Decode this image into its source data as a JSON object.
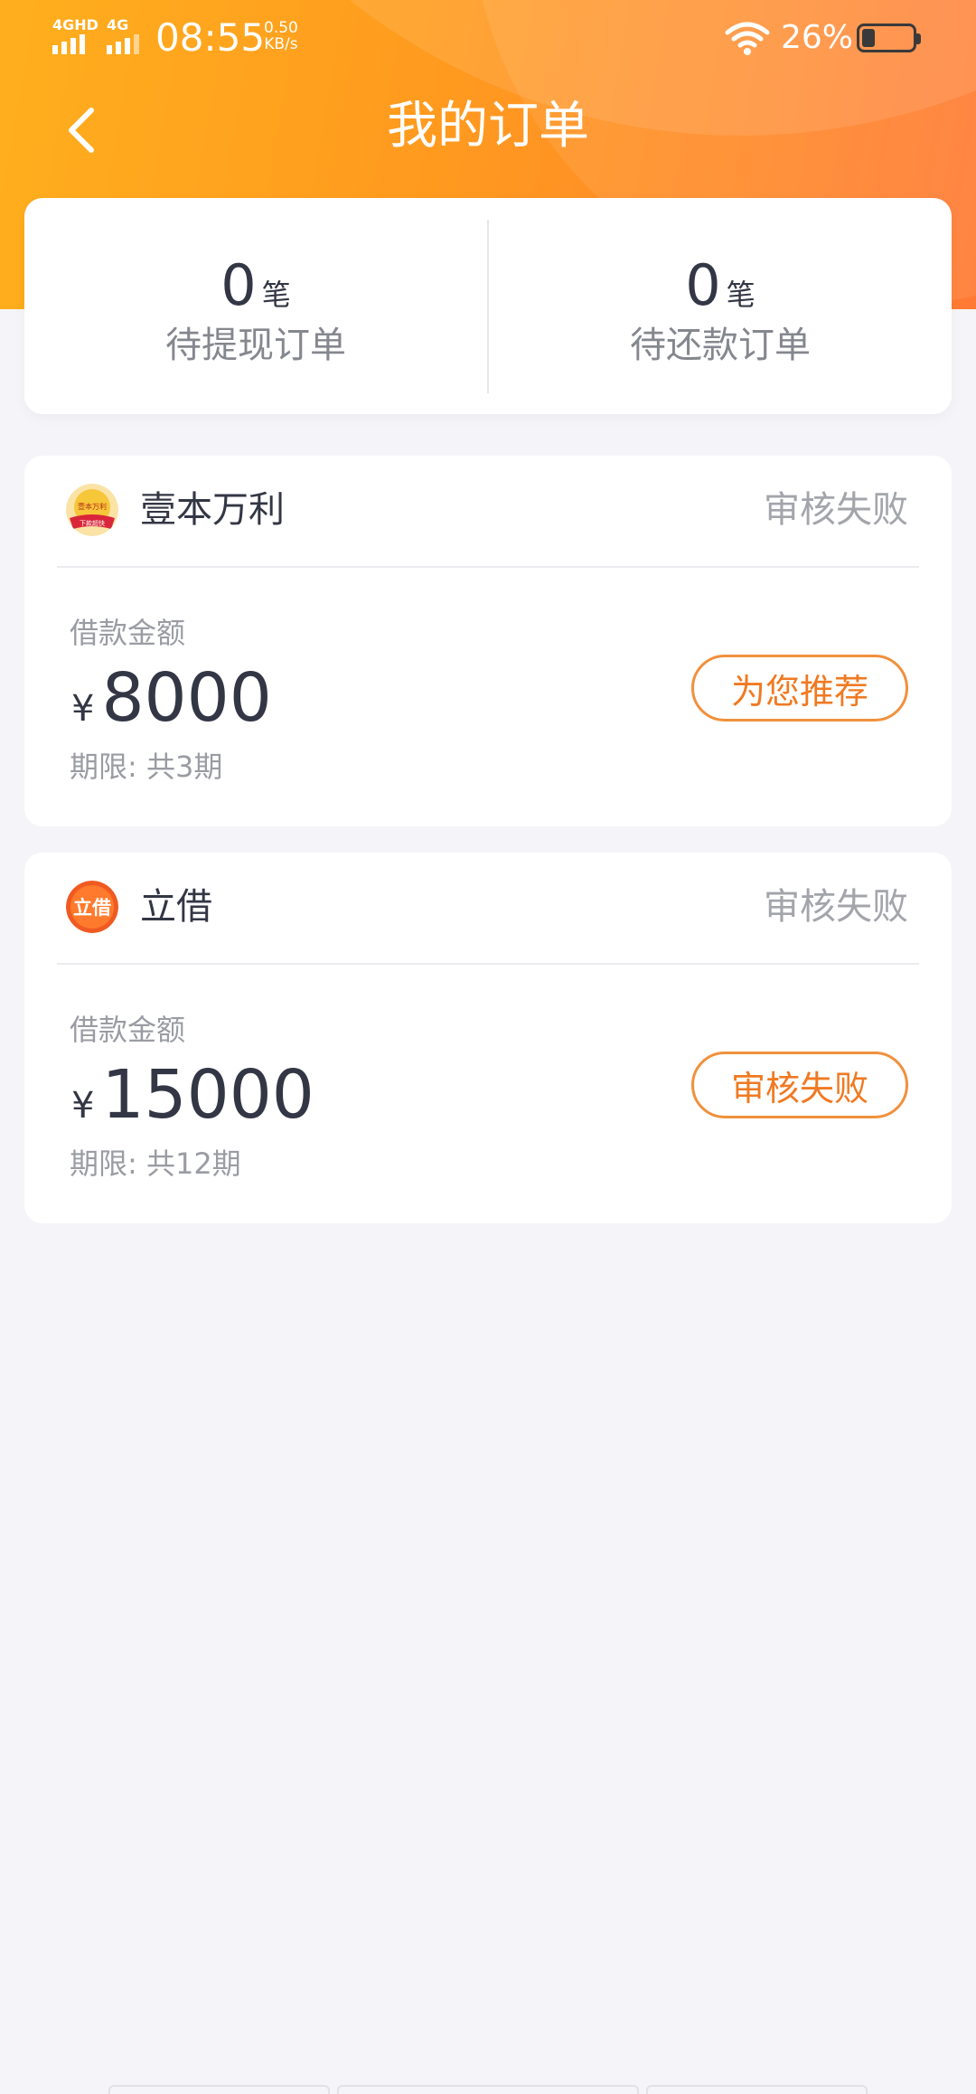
{
  "status_bar": {
    "sim1": "4GHD",
    "sim2": "4G",
    "time": "08:55",
    "speed_value": "0.50",
    "speed_unit": "KB/s",
    "battery_pct": "26%",
    "battery_level": 0.26
  },
  "nav": {
    "title": "我的订单",
    "back_icon": "chevron-left-icon"
  },
  "summary": [
    {
      "count": "0",
      "unit": "笔",
      "label": "待提现订单"
    },
    {
      "count": "0",
      "unit": "笔",
      "label": "待还款订单"
    }
  ],
  "orders": [
    {
      "merchant": "壹本万利",
      "header_status": "审核失败",
      "amount_label": "借款金额",
      "currency": "¥",
      "amount": "8000",
      "term": "期限: 共3期",
      "action_label": "为您推荐",
      "logo_text_top": "壹本万利",
      "logo_text_bottom": "下款超快"
    },
    {
      "merchant": "立借",
      "header_status": "审核失败",
      "amount_label": "借款金额",
      "currency": "¥",
      "amount": "15000",
      "term": "期限: 共12期",
      "action_label": "审核失败",
      "logo_text_top": "立借"
    }
  ],
  "colors": {
    "header_start": "#ffaf1d",
    "header_end": "#ff7a34",
    "accent": "#f07a22",
    "background": "#f5f5f9"
  }
}
